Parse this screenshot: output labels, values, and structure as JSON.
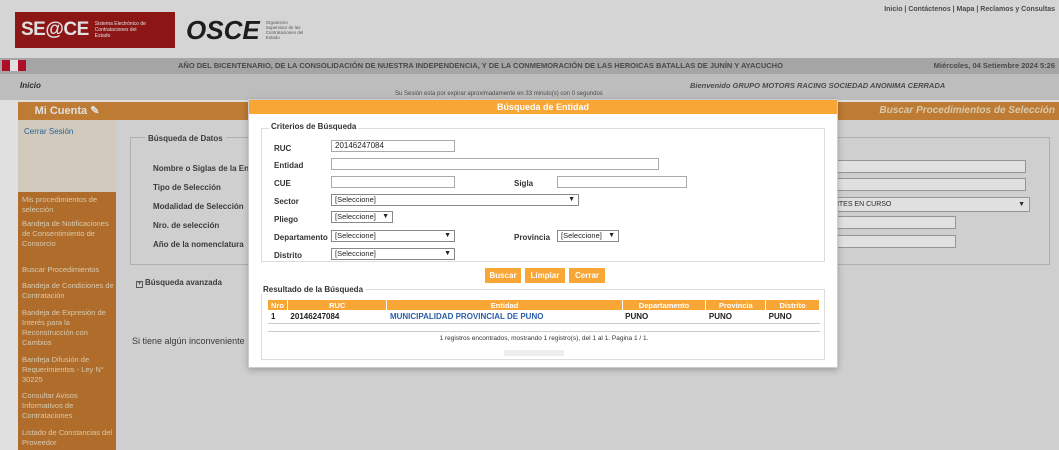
{
  "header": {
    "seace_logo": "SE@CE",
    "seace_sub": "Sistema Electrónico de Contrataciones del Estado",
    "osce_logo": "OSCE",
    "osce_sub": "Organismo Supervisor de las Contrataciones del Estado",
    "top_links": "Inicio | Contáctenos | Mapa | Reclamos y Consultas"
  },
  "banner": {
    "text": "AÑO DEL BICENTENARIO, DE LA CONSOLIDACIÓN DE NUESTRA INDEPENDENCIA, Y DE LA CONMEMORACIÓN DE LAS HEROICAS BATALLAS DE JUNÍN Y AYACUCHO",
    "date": "Miércoles, 04 Setiembre 2024 5:26"
  },
  "breadcrumb": {
    "home": "Inicio",
    "welcome": "Bienvenido GRUPO MOTORS RACING SOCIEDAD ANONIMA CERRADA",
    "session": "Su Sesión esta por expirar aproximadamente en 33 minuto(s) con 0 segundos"
  },
  "sidebar": {
    "title": "Mi Cuenta",
    "logout": "Cerrar Sesión",
    "items": [
      "Mis procedimientos de selección",
      "Bandeja de Notificaciones de Consentimiento de Consorcio",
      "Buscar Procedimientos",
      "Bandeja de Condiciones de Contratación",
      "Bandeja de Expresión de Interés para la Reconstrucción con Cambios",
      "Bandeja Difusión de Requerimientos - Ley N° 30225",
      "Consultar Avisos Informativos de Contrataciones",
      "Listado de Constancias del Proveedor"
    ]
  },
  "main": {
    "title": "Buscar Procedimientos de Selección",
    "legend": "Búsqueda de Datos",
    "labels": [
      "Nombre o Siglas de la Entidad",
      "Tipo de Selección",
      "Modalidad de Selección",
      "Nro. de selección",
      "Año de la nomenclatura"
    ],
    "estado_value": "PANTES EN CURSO",
    "advanced": "Búsqueda avanzada",
    "help": "Si tiene algún inconveniente"
  },
  "modal": {
    "title": "Búsqueda de Entidad",
    "criteria_legend": "Criterios de Búsqueda",
    "ruc_label": "RUC",
    "ruc_value": "20146247084",
    "entidad_label": "Entidad",
    "cue_label": "CUE",
    "sigla_label": "Sigla",
    "sector_label": "Sector",
    "sector_value": "[Seleccione]",
    "pliego_label": "Pliego",
    "pliego_value": "[Seleccione]",
    "departamento_label": "Departamento",
    "departamento_value": "[Seleccione]",
    "provincia_label": "Provincia",
    "provincia_value": "[Seleccione]",
    "distrito_label": "Distrito",
    "distrito_value": "[Seleccione]",
    "buttons": {
      "buscar": "Buscar",
      "limpiar": "Limpiar",
      "cerrar": "Cerrar"
    },
    "result_legend": "Resultado de la Búsqueda",
    "columns": [
      "Nro",
      "RUC",
      "Entidad",
      "Departamento",
      "Provincia",
      "Distrito"
    ],
    "rows": [
      {
        "nro": "1",
        "ruc": "20146247084",
        "entidad": "MUNICIPALIDAD PROVINCIAL DE PUNO",
        "departamento": "PUNO",
        "provincia": "PUNO",
        "distrito": "PUNO"
      }
    ],
    "count": "1 registros encontrados, mostrando 1 registro(s), del 1 al 1. Pagina 1 / 1."
  },
  "colors": {
    "accent": "#f8a635",
    "sidebar": "#c87b30",
    "brand_red": "#a01919"
  }
}
